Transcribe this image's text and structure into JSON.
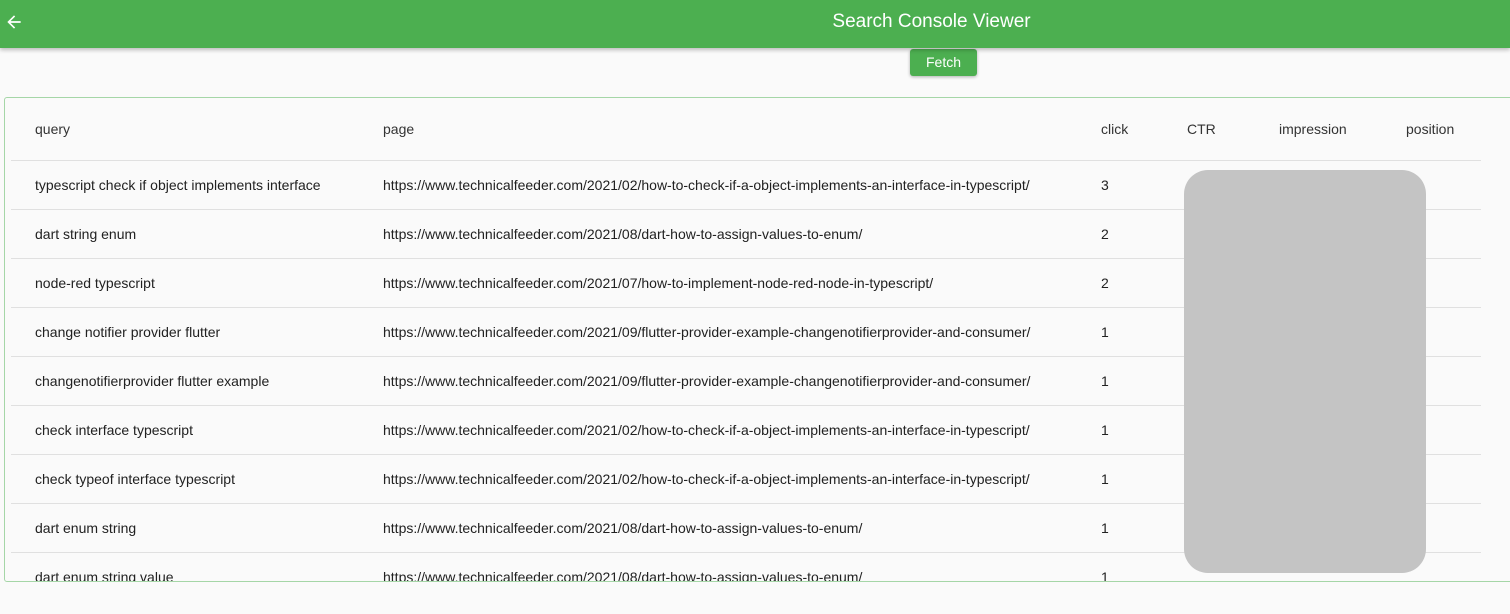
{
  "appbar": {
    "title": "Search Console Viewer",
    "back_icon": "arrow-back-icon",
    "color": "#4caf50"
  },
  "toolbar": {
    "fetch_label": "Fetch"
  },
  "table": {
    "columns": [
      "query",
      "page",
      "click",
      "CTR",
      "impression",
      "position"
    ],
    "rows": [
      {
        "query": "typescript check if object implements interface",
        "page": "https://www.technicalfeeder.com/2021/02/how-to-check-if-a-object-implements-an-interface-in-typescript/",
        "click": "3",
        "ctr": "",
        "impression": "",
        "position": ""
      },
      {
        "query": "dart string enum",
        "page": "https://www.technicalfeeder.com/2021/08/dart-how-to-assign-values-to-enum/",
        "click": "2",
        "ctr": "",
        "impression": "",
        "position": ""
      },
      {
        "query": "node-red typescript",
        "page": "https://www.technicalfeeder.com/2021/07/how-to-implement-node-red-node-in-typescript/",
        "click": "2",
        "ctr": "",
        "impression": "",
        "position": ""
      },
      {
        "query": "change notifier provider flutter",
        "page": "https://www.technicalfeeder.com/2021/09/flutter-provider-example-changenotifierprovider-and-consumer/",
        "click": "1",
        "ctr": "",
        "impression": "",
        "position": ""
      },
      {
        "query": "changenotifierprovider flutter example",
        "page": "https://www.technicalfeeder.com/2021/09/flutter-provider-example-changenotifierprovider-and-consumer/",
        "click": "1",
        "ctr": "",
        "impression": "",
        "position": ""
      },
      {
        "query": "check interface typescript",
        "page": "https://www.technicalfeeder.com/2021/02/how-to-check-if-a-object-implements-an-interface-in-typescript/",
        "click": "1",
        "ctr": "",
        "impression": "",
        "position": ""
      },
      {
        "query": "check typeof interface typescript",
        "page": "https://www.technicalfeeder.com/2021/02/how-to-check-if-a-object-implements-an-interface-in-typescript/",
        "click": "1",
        "ctr": "",
        "impression": "",
        "position": ""
      },
      {
        "query": "dart enum string",
        "page": "https://www.technicalfeeder.com/2021/08/dart-how-to-assign-values-to-enum/",
        "click": "1",
        "ctr": "",
        "impression": "",
        "position": ""
      },
      {
        "query": "dart enum string value",
        "page": "https://www.technicalfeeder.com/2021/08/dart-how-to-assign-values-to-enum/",
        "click": "1",
        "ctr": "",
        "impression": "",
        "position": ""
      }
    ]
  }
}
